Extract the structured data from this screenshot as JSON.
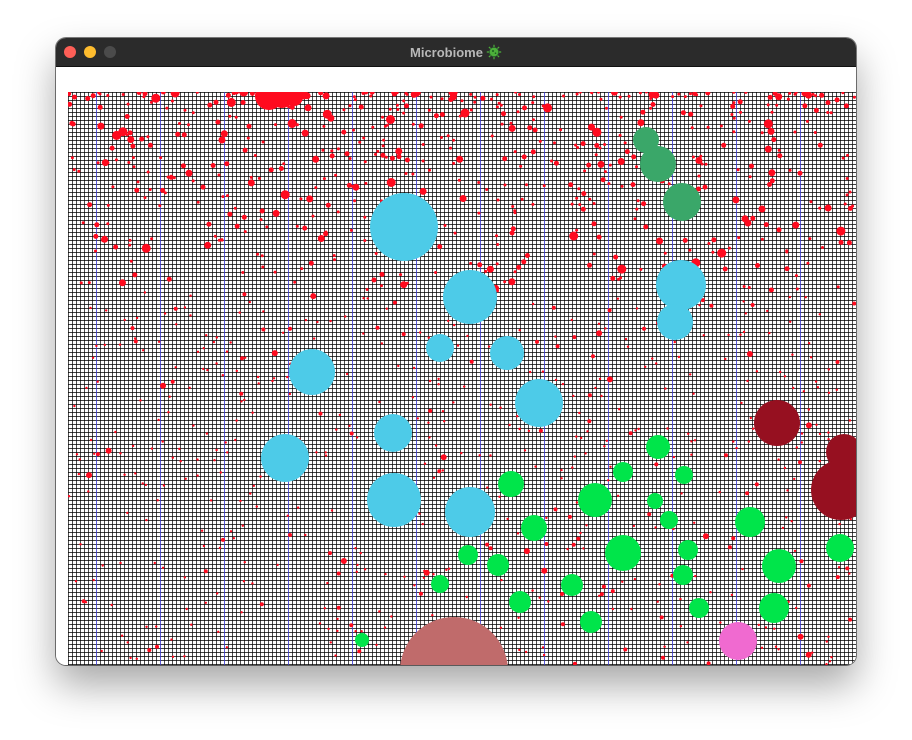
{
  "window": {
    "title": "Microbiome",
    "title_icon": "microbe-icon",
    "controls": [
      "close",
      "minimize",
      "maximize"
    ],
    "colors": {
      "close": "#fe5f57",
      "minimize": "#febc2e",
      "maximize": "#4b4b4b",
      "titlebar": "#2b2b2b"
    }
  },
  "simulation": {
    "background": "#ffffff",
    "grid_line_color": "#000000",
    "grid_accent_color": "#3333cc",
    "colors": {
      "red_cells": "#ff0a1e",
      "blue_colonies": "#4dcbe8",
      "green_colonies": "#00e54a",
      "dark_green_colonies": "#3aa769",
      "dark_red_colonies": "#961020",
      "salmon_colony": "#c06b6b",
      "pink_colony": "#f06ad0"
    }
  }
}
